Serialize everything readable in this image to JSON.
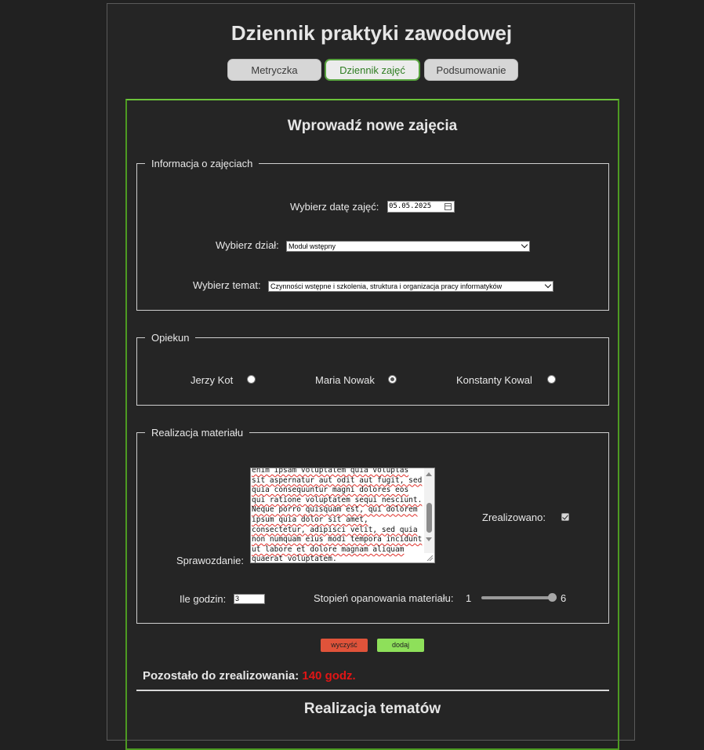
{
  "title": "Dziennik praktyki zawodowej",
  "tabs": [
    {
      "label": "Metryczka",
      "active": false
    },
    {
      "label": "Dziennik zajęć",
      "active": true
    },
    {
      "label": "Podsumowanie",
      "active": false
    }
  ],
  "form_title": "Wprowadź nowe zajęcia",
  "info": {
    "legend": "Informacja o zajęciach",
    "date_label": "Wybierz datę zajęć:",
    "date_value": "05.05.2025",
    "dept_label": "Wybierz dział:",
    "dept_value": "Moduł wstępny",
    "topic_label": "Wybierz temat:",
    "topic_value": "Czynności wstępne i szkolenia, struktura i organizacja pracy informatyków"
  },
  "guardian": {
    "legend": "Opiekun",
    "options": [
      {
        "label": "Jerzy Kot",
        "checked": false
      },
      {
        "label": "Maria Nowak",
        "checked": true
      },
      {
        "label": "Konstanty Kowal",
        "checked": false
      }
    ]
  },
  "material": {
    "legend": "Realizacja materiału",
    "report_label": "Sprawozdanie:",
    "report_text": "enim ipsam voluptatem quia voluptas sit aspernatur aut odit aut fugit, sed quia consequuntur magni dolores eos qui ratione voluptatem sequi nesciunt. Neque porro quisquam est, qui dolorem ipsum quia dolor sit amet, consectetur, adipisci velit, sed quia non numquam eius modi tempora incidunt ut labore et dolore magnam aliquam quaerat voluptatem.",
    "done_label": "Zrealizowano:",
    "done_checked": true,
    "hours_label": "Ile godzin:",
    "hours_value": "3",
    "mastery_label": "Stopień opanowania materiału:",
    "mastery_min": "1",
    "mastery_max": "6",
    "mastery_value": 6
  },
  "buttons": {
    "clear": "wyczyść",
    "add": "dodaj"
  },
  "remaining_label": "Pozostało do zrealizowania:",
  "remaining_value": "140 godz.",
  "topics_title": "Realizacja tematów"
}
